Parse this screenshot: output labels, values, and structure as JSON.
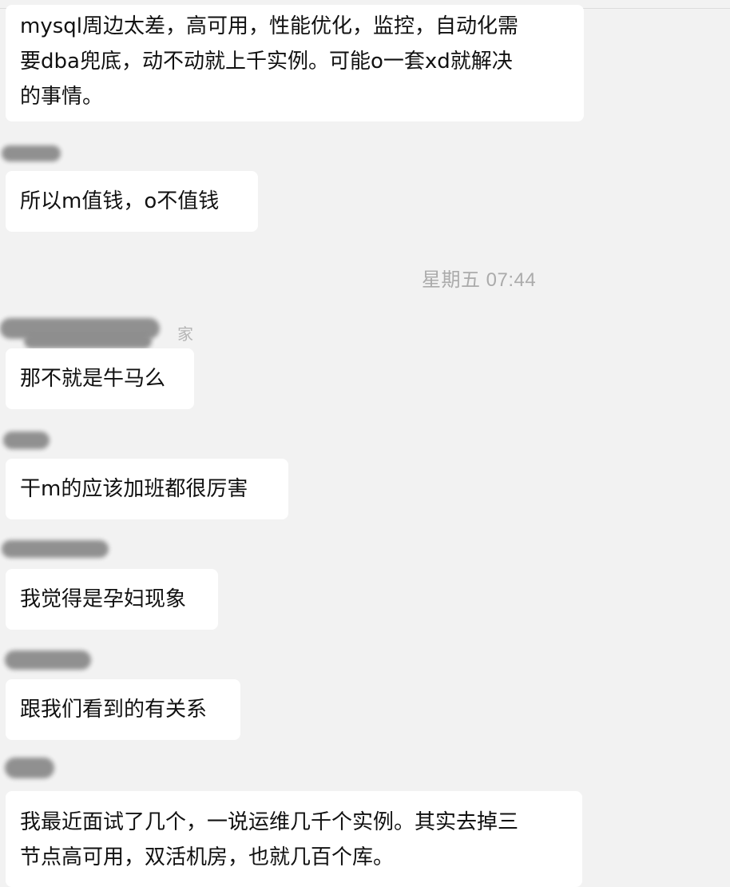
{
  "chat": {
    "timestamp": "星期五 07:44",
    "messages": [
      {
        "lines": [
          "mysql周边太差，高可用，性能优化，监控，自动化需",
          "要dba兜底，动不动就上千实例。可能o一套xd就解决",
          "的事情。"
        ]
      },
      {
        "lines": [
          "所以m值钱，o不值钱"
        ]
      },
      {
        "lines": [
          "那不就是牛马么"
        ]
      },
      {
        "lines": [
          "干m的应该加班都很厉害"
        ]
      },
      {
        "lines": [
          "我觉得是孕妇现象"
        ]
      },
      {
        "lines": [
          "跟我们看到的有关系"
        ]
      },
      {
        "lines": [
          "我最近面试了几个，一说运维几千个实例。其实去掉三",
          "节点高可用，双活机房，也就几百个库。"
        ]
      }
    ],
    "partial_sender_fragment": "家"
  }
}
